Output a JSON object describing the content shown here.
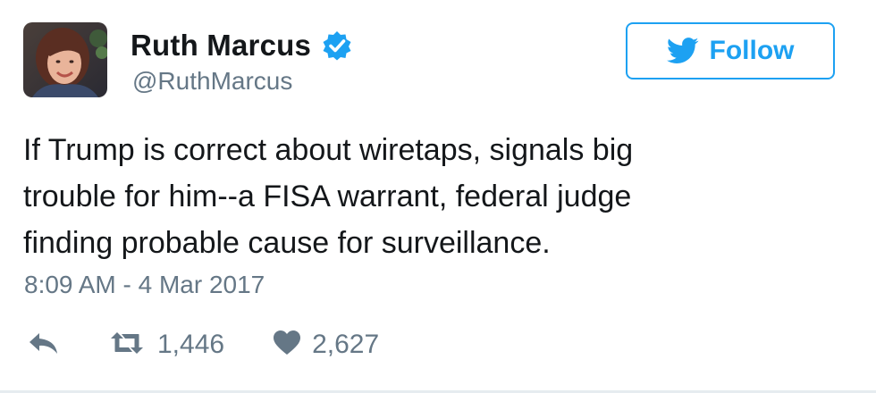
{
  "author": {
    "name": "Ruth Marcus",
    "handle": "@RuthMarcus",
    "verified": true,
    "avatar_icon": "profile-photo"
  },
  "follow_button": {
    "label": "Follow",
    "icon": "twitter-bird-icon",
    "color": "#1da1f2"
  },
  "tweet": {
    "text_lines": [
      "If Trump is correct about wiretaps, signals big",
      "trouble for him--a FISA warrant, federal judge",
      "finding probable cause for surveillance."
    ],
    "timestamp": "8:09 AM - 4 Mar 2017"
  },
  "actions": {
    "reply": {
      "icon": "reply-icon"
    },
    "retweet": {
      "icon": "retweet-icon",
      "count": "1,446"
    },
    "like": {
      "icon": "heart-icon",
      "count": "2,627"
    }
  },
  "colors": {
    "text": "#14171a",
    "muted": "#657786",
    "accent": "#1da1f2"
  }
}
